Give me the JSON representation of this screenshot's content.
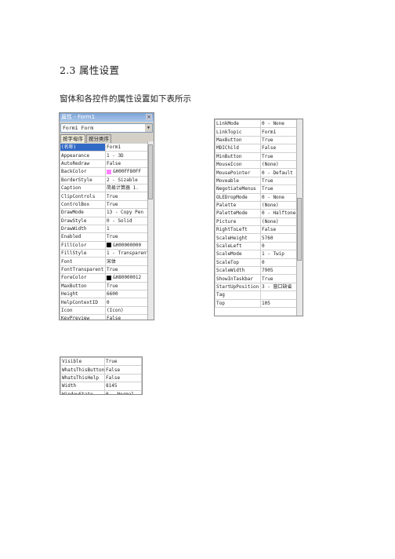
{
  "heading": "2.3 属性设置",
  "paragraph": "窗体和各控件的属性设置如下表所示",
  "panel1": {
    "title": "属性 - Form1",
    "close_glyph": "×",
    "combo_value": "Form1 Form",
    "combo_arrow": "▼",
    "tabs": [
      "按字母序",
      "按分类序"
    ],
    "rows": [
      {
        "k": "(名称)",
        "v": "Form1"
      },
      {
        "k": "Appearance",
        "v": "1 - 3D"
      },
      {
        "k": "AutoRedraw",
        "v": "False"
      },
      {
        "k": "BackColor",
        "v": "&H00FF80FF",
        "swatch": "#ff80ff"
      },
      {
        "k": "BorderStyle",
        "v": "2 - Sizable"
      },
      {
        "k": "Caption",
        "v": "简易计算器 1."
      },
      {
        "k": "ClipControls",
        "v": "True"
      },
      {
        "k": "ControlBox",
        "v": "True"
      },
      {
        "k": "DrawMode",
        "v": "13 - Copy Pen"
      },
      {
        "k": "DrawStyle",
        "v": "0 - Solid"
      },
      {
        "k": "DrawWidth",
        "v": "1"
      },
      {
        "k": "Enabled",
        "v": "True"
      },
      {
        "k": "FillColor",
        "v": "&H00000000",
        "swatch": "#000000"
      },
      {
        "k": "FillStyle",
        "v": "1 - Transparent"
      },
      {
        "k": "Font",
        "v": "宋体"
      },
      {
        "k": "FontTransparent",
        "v": "True"
      },
      {
        "k": "ForeColor",
        "v": "&H80000012",
        "swatch": "#000000"
      },
      {
        "k": "MaxButton",
        "v": "True"
      },
      {
        "k": "Height",
        "v": "6600"
      },
      {
        "k": "HelpContextID",
        "v": "0"
      },
      {
        "k": "Icon",
        "v": "(Icon)"
      },
      {
        "k": "KeyPreview",
        "v": "False"
      },
      {
        "k": "Left",
        "v": "105"
      }
    ]
  },
  "panel2": {
    "rows": [
      {
        "k": "LinkMode",
        "v": "0 - None"
      },
      {
        "k": "LinkTopic",
        "v": "Form1"
      },
      {
        "k": "MaxButton",
        "v": "True"
      },
      {
        "k": "MDIChild",
        "v": "False"
      },
      {
        "k": "MinButton",
        "v": "True"
      },
      {
        "k": "MouseIcon",
        "v": "(None)"
      },
      {
        "k": "MousePointer",
        "v": "0 - Default"
      },
      {
        "k": "Moveable",
        "v": "True"
      },
      {
        "k": "NegotiateMenus",
        "v": "True"
      },
      {
        "k": "OLEDropMode",
        "v": "0 - None"
      },
      {
        "k": "Palette",
        "v": "(None)"
      },
      {
        "k": "PaletteMode",
        "v": "0 - Halftone"
      },
      {
        "k": "Picture",
        "v": "(None)"
      },
      {
        "k": "RightToLeft",
        "v": "False"
      },
      {
        "k": "ScaleHeight",
        "v": "5760"
      },
      {
        "k": "ScaleLeft",
        "v": "0"
      },
      {
        "k": "ScaleMode",
        "v": "1 - Twip"
      },
      {
        "k": "ScaleTop",
        "v": "0"
      },
      {
        "k": "ScaleWidth",
        "v": "7905"
      },
      {
        "k": "ShowInTaskbar",
        "v": "True"
      },
      {
        "k": "StartUpPosition",
        "v": "3 - 窗口缺省"
      },
      {
        "k": "Tag",
        "v": ""
      },
      {
        "k": "Top",
        "v": "105"
      }
    ]
  },
  "panel3": {
    "rows": [
      {
        "k": "Visible",
        "v": "True"
      },
      {
        "k": "WhatsThisButton",
        "v": "False"
      },
      {
        "k": "WhatsThisHelp",
        "v": "False"
      },
      {
        "k": "Width",
        "v": "8145"
      },
      {
        "k": "WindowState",
        "v": "0 - Normal"
      }
    ]
  }
}
